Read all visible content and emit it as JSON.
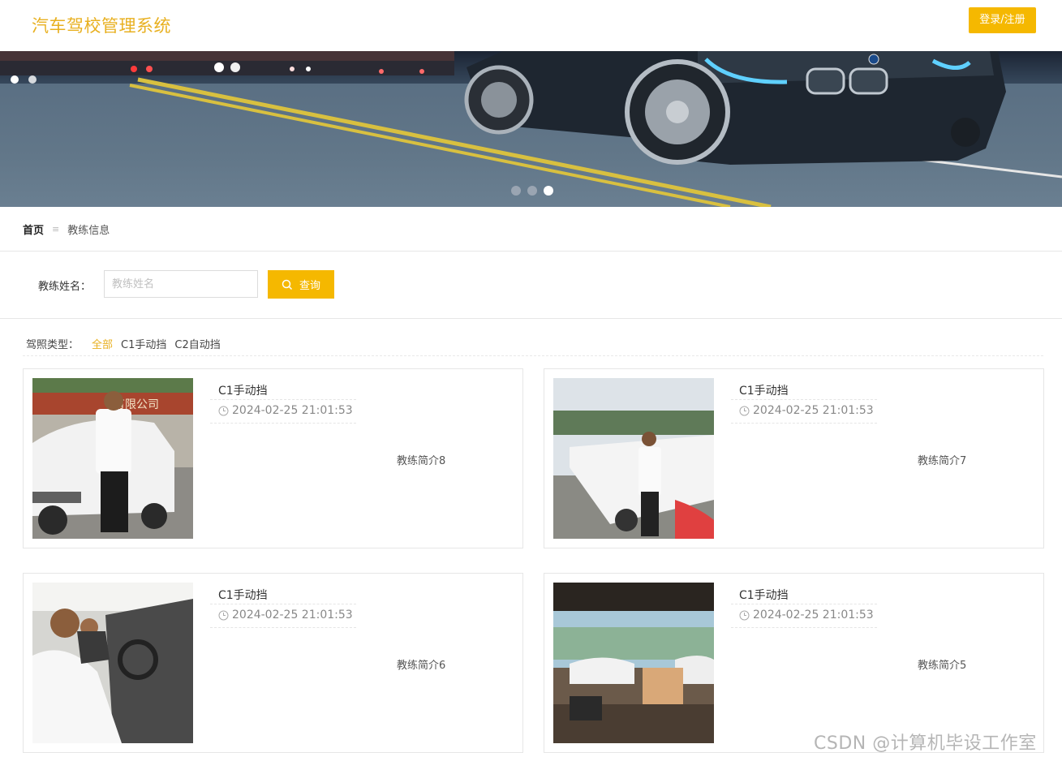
{
  "header": {
    "title": "汽车驾校管理系统",
    "login_label": "登录/注册"
  },
  "banner": {
    "slide_count": 3,
    "active_slide": 3
  },
  "breadcrumb": {
    "home": "首页",
    "separator": "≡",
    "current": "教练信息"
  },
  "search": {
    "label": "教练姓名：",
    "placeholder": "教练姓名",
    "value": "",
    "button_label": "查询"
  },
  "filter": {
    "label": "驾照类型：",
    "options": [
      "全部",
      "C1手动挡",
      "C2自动挡"
    ],
    "active": "全部"
  },
  "cards": [
    {
      "type": "C1手动挡",
      "time": "2024-02-25 21:01:53",
      "intro": "教练简介8"
    },
    {
      "type": "C1手动挡",
      "time": "2024-02-25 21:01:53",
      "intro": "教练简介7"
    },
    {
      "type": "C1手动挡",
      "time": "2024-02-25 21:01:53",
      "intro": "教练简介6"
    },
    {
      "type": "C1手动挡",
      "time": "2024-02-25 21:01:53",
      "intro": "教练简介5"
    }
  ],
  "photo_sign_text": "有限公司",
  "watermark": "CSDN @计算机毕设工作室",
  "colors": {
    "accent": "#f5b800",
    "title": "#e8b020"
  }
}
